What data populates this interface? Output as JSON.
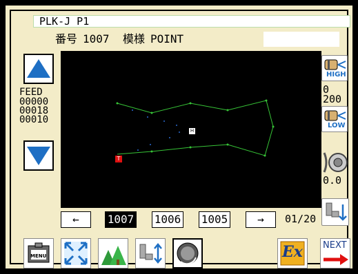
{
  "header": {
    "title": "PLK-J P1",
    "number_label": "番号",
    "number_value": "1007",
    "pattern_label": "模様",
    "pattern_value": "POINT"
  },
  "left_panel": {
    "feed_label": "FEED",
    "feed_values": [
      "00000",
      "00018",
      "00010"
    ]
  },
  "right_panel": {
    "high_label": "HIGH",
    "low_label": "LOW",
    "speed_values": [
      "0",
      "200"
    ],
    "tension_value": "0.0"
  },
  "nav": {
    "prev_arrow": "←",
    "next_arrow": "→",
    "items": [
      "1007",
      "1006",
      "1005"
    ],
    "page_indicator": "01/20"
  },
  "toolbar": {
    "menu_label": "MENU",
    "ex_label": "Ex",
    "next_label": "NEXT"
  },
  "canvas": {
    "start_marker": "T",
    "home_marker": "H"
  },
  "colors": {
    "background": "#f3ecc8",
    "arrow_blue": "#1e6fc4",
    "stitch_green": "#37c437",
    "marker_red": "#e01010"
  }
}
